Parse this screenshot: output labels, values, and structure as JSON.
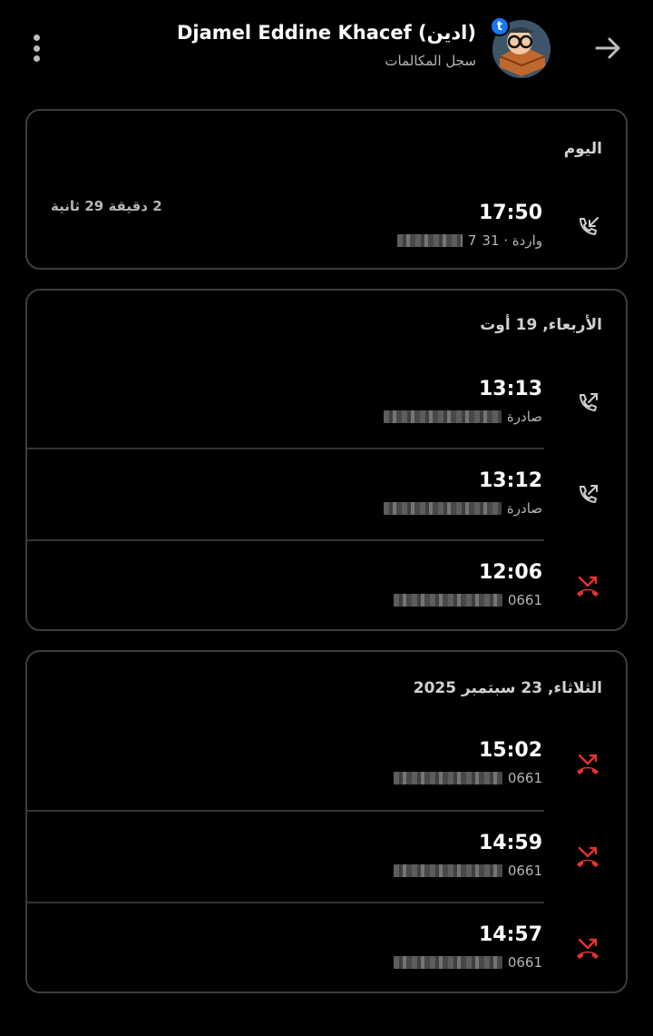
{
  "header": {
    "title": "Djamel Eddine Khacef (ادين)",
    "subtitle": "سجل المكالمات",
    "badge": "t"
  },
  "icons": {
    "menu": "more-vert-icon",
    "back": "arrow-forward-icon",
    "incoming": "call-received-icon",
    "outgoing": "call-made-icon",
    "missed": "call-missed-icon"
  },
  "colors": {
    "missed": "#e5322d",
    "accent": "#1877f2"
  },
  "sections": [
    {
      "label": "اليوم",
      "calls": [
        {
          "time": "17:50",
          "meta_prefix": "واردة · 31",
          "meta_number_visible": "7",
          "duration": "2 دقيقة 29 ثانية",
          "type": "incoming"
        }
      ]
    },
    {
      "label": "الأربعاء, 19 أوت",
      "calls": [
        {
          "time": "13:13",
          "meta_prefix": "صادرة",
          "type": "outgoing"
        },
        {
          "time": "13:12",
          "meta_prefix": "صادرة",
          "type": "outgoing"
        },
        {
          "time": "12:06",
          "meta_prefix": "0661",
          "type": "missed"
        }
      ]
    },
    {
      "label": "الثلاثاء, 23 سبتمبر 2025",
      "calls": [
        {
          "time": "15:02",
          "meta_prefix": "0661",
          "type": "missed"
        },
        {
          "time": "14:59",
          "meta_prefix": "0661",
          "type": "missed"
        },
        {
          "time": "14:57",
          "meta_prefix": "0661",
          "type": "missed"
        }
      ]
    }
  ]
}
